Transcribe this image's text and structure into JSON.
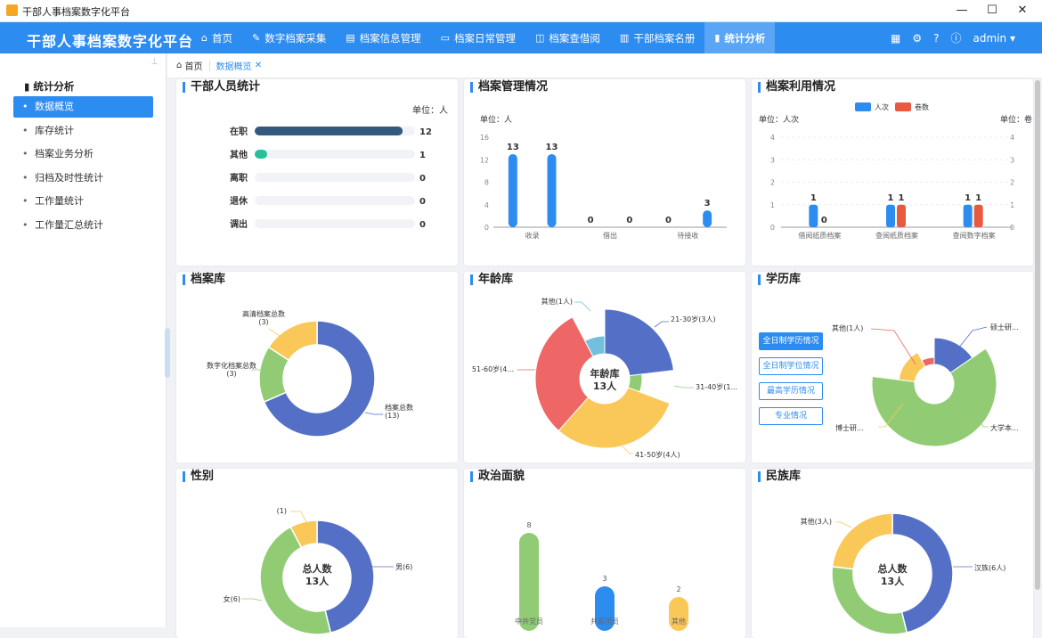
{
  "window": {
    "title": "干部人事档案数字化平台",
    "minimize": "—",
    "maximize": "☐",
    "close": "✕"
  },
  "header": {
    "brand": "干部人事档案数字化平台",
    "nav": [
      {
        "icon": "⌂",
        "label": "首页"
      },
      {
        "icon": "✎",
        "label": "数字档案采集"
      },
      {
        "icon": "▤",
        "label": "档案信息管理"
      },
      {
        "icon": "▭",
        "label": "档案日常管理"
      },
      {
        "icon": "◫",
        "label": "档案查借阅"
      },
      {
        "icon": "▥",
        "label": "干部档案名册"
      },
      {
        "icon": "▮",
        "label": "统计分析"
      }
    ],
    "user": "admin"
  },
  "sidebar": {
    "group": "统计分析",
    "items": [
      {
        "label": "数据概览"
      },
      {
        "label": "库存统计"
      },
      {
        "label": "档案业务分析"
      },
      {
        "label": "归档及时性统计"
      },
      {
        "label": "工作量统计"
      },
      {
        "label": "工作量汇总统计"
      }
    ]
  },
  "breadcrumb": {
    "home": "首页",
    "current": "数据概览"
  },
  "colors": {
    "primary": "#2d8cf0",
    "blue": "#5470c6",
    "green": "#91cc75",
    "yellow": "#fac858",
    "red": "#ee6666",
    "cyan": "#73c0de",
    "navy": "#34597f",
    "teal": "#26c19a"
  },
  "panels": {
    "personnel": {
      "title": "干部人员统计",
      "unit": "单位：人"
    },
    "management": {
      "title": "档案管理情况",
      "unit": "单位：人"
    },
    "utilization": {
      "title": "档案利用情况",
      "unit_left": "单位：人次",
      "unit_right": "单位：卷"
    },
    "archive": {
      "title": "档案库"
    },
    "age": {
      "title": "年龄库",
      "center": "年龄库",
      "center_value": "13人"
    },
    "education": {
      "title": "学历库",
      "buttons": [
        "全日制学历情况",
        "全日制学位情况",
        "最高学历情况",
        "专业情况"
      ]
    },
    "gender": {
      "title": "性别",
      "center": "总人数",
      "center_value": "13人"
    },
    "political": {
      "title": "政治面貌"
    },
    "ethnic": {
      "title": "民族库",
      "center": "总人数",
      "center_value": "13人"
    }
  },
  "chart_data": [
    {
      "type": "bar",
      "categories": [
        "在职",
        "其他",
        "离职",
        "退休",
        "调出"
      ],
      "values": [
        12,
        1,
        0,
        0,
        0
      ],
      "xlim": [
        0,
        13
      ]
    },
    {
      "type": "bar",
      "categories": [
        "收录",
        "借出",
        "待接收"
      ],
      "values": [
        13,
        13,
        0,
        0,
        0,
        3
      ],
      "ylim": [
        0,
        16
      ],
      "yticks": [
        "0",
        "4",
        "8",
        "12",
        "16"
      ]
    },
    {
      "type": "bar",
      "categories": [
        "借阅纸质档案",
        "查阅纸质档案",
        "查阅数字档案"
      ],
      "legend": [
        "人次",
        "卷数"
      ],
      "series": [
        {
          "name": "人次",
          "values": [
            1,
            1,
            1
          ]
        },
        {
          "name": "卷数",
          "values": [
            0,
            1,
            1
          ]
        }
      ],
      "ylim": [
        0,
        4
      ],
      "yticks": [
        "0",
        "1",
        "2",
        "3",
        "4"
      ]
    },
    {
      "type": "pie",
      "labels": [
        "档案总数\n(13)",
        "数字化档案总数\n(3)",
        "高清档案总数\n(3)"
      ],
      "values": [
        13,
        3,
        3
      ]
    },
    {
      "type": "pie",
      "labels": [
        "21-30岁(3人)",
        "31-40岁(1...",
        "41-50岁(4人)",
        "51-60岁(4...",
        "其他(1人)"
      ],
      "values": [
        3,
        1,
        4,
        4,
        1
      ]
    },
    {
      "type": "pie",
      "labels": [
        "硕士研...",
        "大学本...",
        "博士研...",
        "其他(1人)"
      ],
      "values": [
        2,
        8,
        2,
        1
      ]
    },
    {
      "type": "pie",
      "labels": [
        "男(6)",
        "女(6)",
        "(1)"
      ],
      "values": [
        6,
        6,
        1
      ]
    },
    {
      "type": "bar",
      "categories": [
        "中共党员",
        "共青团员",
        "其他"
      ],
      "values": [
        8,
        3,
        2
      ]
    },
    {
      "type": "pie",
      "labels": [
        "汉族(6人)",
        "",
        "其他(3人)"
      ],
      "values": [
        6,
        4,
        3
      ]
    }
  ]
}
